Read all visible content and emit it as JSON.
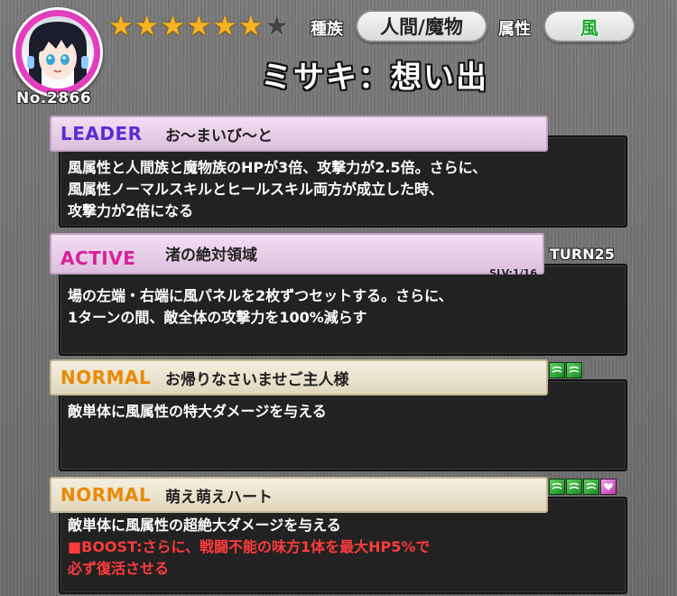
{
  "header": {
    "number": "No.2866",
    "stars": {
      "filled": 6,
      "total": 7
    },
    "race_label": "種族",
    "race_value": "人間/魔物",
    "attribute_label": "属性",
    "attribute_value": "風",
    "character_name": "ミサキ：想い出"
  },
  "skills": [
    {
      "type": "LEADER",
      "name": "お～まいび～と",
      "lines": [
        "風属性と人間族と魔物族のHPが3倍、攻撃力が2.5倍。さらに、",
        "風属性ノーマルスキルとヒールスキル両方が成立した時、",
        "攻撃力が2倍になる"
      ]
    },
    {
      "type": "ACTIVE",
      "name": "渚の絶対領域",
      "slv": "SLV:1/16",
      "turn": "TURN25",
      "lines": [
        "場の左端・右端に風パネルを2枚ずつセットする。さらに、",
        "1ターンの間、敵全体の攻撃力を100%減らす"
      ]
    },
    {
      "type": "NORMAL",
      "name": "お帰りなさいませご主人様",
      "panels": [
        "wind",
        "wind"
      ],
      "lines": [
        "敵単体に風属性の特大ダメージを与える"
      ]
    },
    {
      "type": "NORMAL",
      "name": "萌え萌えハート",
      "panels": [
        "wind",
        "wind",
        "wind",
        "heart"
      ],
      "lines": [
        "敵単体に風属性の超絶大ダメージを与える"
      ],
      "boost_lines": [
        "■BOOST:さらに、戦闘不能の味方1体を最大HP5%で",
        "必ず復活させる"
      ]
    }
  ],
  "colors": {
    "leader": "#5a2bd6",
    "active": "#d8209a",
    "normal": "#e88a06",
    "wind": "#1aa62a",
    "boost": "#ff3b3b"
  }
}
